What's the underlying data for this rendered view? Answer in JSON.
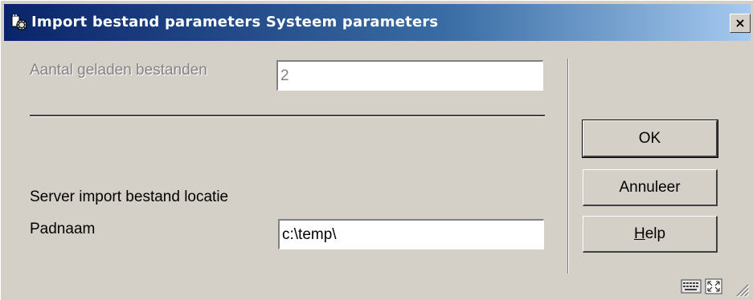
{
  "window": {
    "title": "Import bestand parameters Systeem parameters",
    "close_label": "×"
  },
  "form": {
    "loaded_files": {
      "label": "Aantal geladen bestanden",
      "value": "2"
    },
    "section_heading": "Server import bestand locatie",
    "path": {
      "label": "Padnaam",
      "value": "c:\\temp\\"
    }
  },
  "buttons": {
    "ok": "OK",
    "cancel": "Annuleer",
    "help_prefix": "H",
    "help_rest": "elp"
  },
  "colors": {
    "title_start": "#0a246a",
    "title_end": "#a6caf0",
    "face": "#d4d0c8"
  },
  "icons": {
    "title": "app-icon",
    "status1": "keyboard-icon",
    "status2": "resize-arrows-icon",
    "grip": "size-grip-icon"
  }
}
